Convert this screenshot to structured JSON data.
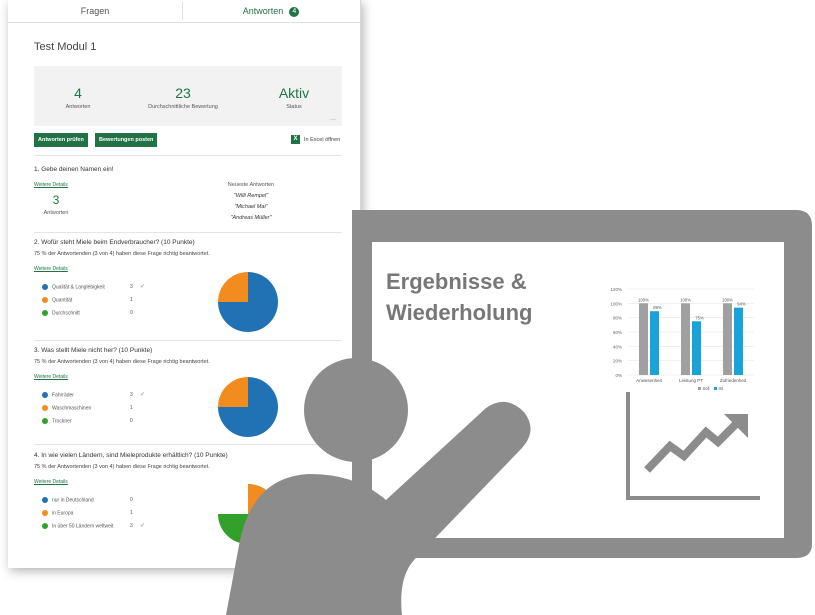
{
  "tabs": {
    "questions": "Fragen",
    "answers": "Antworten",
    "answers_badge": "4"
  },
  "form_title": "Test Modul 1",
  "stats": [
    {
      "value": "4",
      "label": "Antworten"
    },
    {
      "value": "23",
      "label": "Durchschnittliche Bewertung"
    },
    {
      "value": "Aktiv",
      "label": "Status"
    }
  ],
  "more": "...",
  "buttons": {
    "review": "Antworten prüfen",
    "post_scores": "Bewertungen posten",
    "excel": "In Excel öffnen",
    "excel_icon": "X"
  },
  "more_details": "Weitere Details",
  "q1": {
    "title": "1.  Gebe deinen Namen ein!",
    "count": "3",
    "count_label": "Antworten",
    "recent_label": "Neueste Antworten",
    "recent": [
      "\"Willi Rempel\"",
      "\"Michael Mai\"",
      "\"Andreas Müller\""
    ]
  },
  "q2": {
    "title": "2.  Wofür steht Miele beim Endverbraucher? (10 Punkte)",
    "summary": "75 % der Antwortenden (3 von 4) haben diese Frage richtig beantwortet.",
    "options": [
      {
        "label": "Qualität & Langlebigkeit",
        "count": "3",
        "correct": true,
        "color": "#2171b5"
      },
      {
        "label": "Quantität",
        "count": "1",
        "correct": false,
        "color": "#f28c1e"
      },
      {
        "label": "Durchschnitt",
        "count": "0",
        "correct": false,
        "color": "#33a02c"
      }
    ]
  },
  "q3": {
    "title": "3.  Was stellt Miele nicht her? (10 Punkte)",
    "summary": "75 % der Antwortenden (3 von 4) haben diese Frage richtig beantwortet.",
    "options": [
      {
        "label": "Fahrräder",
        "count": "3",
        "correct": true,
        "color": "#2171b5"
      },
      {
        "label": "Waschmaschinen",
        "count": "1",
        "correct": false,
        "color": "#f28c1e"
      },
      {
        "label": "Trockner",
        "count": "0",
        "correct": false,
        "color": "#33a02c"
      }
    ]
  },
  "q4": {
    "title": "4.  In wie vielen Ländern, sind Mieleprodukte erhältlich? (10 Punkte)",
    "summary": "75 % der Antwortenden (3 von 4) haben diese Frage richtig beantwortet.",
    "options": [
      {
        "label": "nur in Deutschland",
        "count": "0",
        "correct": false,
        "color": "#2171b5"
      },
      {
        "label": "in Europa",
        "count": "1",
        "correct": false,
        "color": "#f28c1e"
      },
      {
        "label": "In über 50 Ländern weltweit",
        "count": "3",
        "correct": true,
        "color": "#33a02c"
      }
    ]
  },
  "check_glyph": "✓",
  "board": {
    "heading_line1": "Ergebnisse &",
    "heading_line2": "Wiederholung"
  },
  "colors": {
    "accent": "#217346",
    "figure": "#8c8c8c",
    "series_soll": "#a0a0a0",
    "series_ist": "#1aa3d9"
  },
  "chart_data": {
    "type": "bar",
    "categories": [
      "Anwesenheit",
      "Leistung PT",
      "Zufriedenheit"
    ],
    "series": [
      {
        "name": "Soll",
        "values": [
          100,
          100,
          100
        ]
      },
      {
        "name": "Ist",
        "values": [
          89,
          75,
          94
        ]
      }
    ],
    "data_labels": {
      "Soll": [
        "100%",
        "100%",
        "100%"
      ],
      "Ist": [
        "89%",
        "75%",
        "94%"
      ]
    },
    "ylim": [
      0,
      120
    ],
    "yticks": [
      "0%",
      "20%",
      "40%",
      "60%",
      "80%",
      "100%",
      "120%"
    ],
    "legend": "bottom-right",
    "grid": true
  }
}
